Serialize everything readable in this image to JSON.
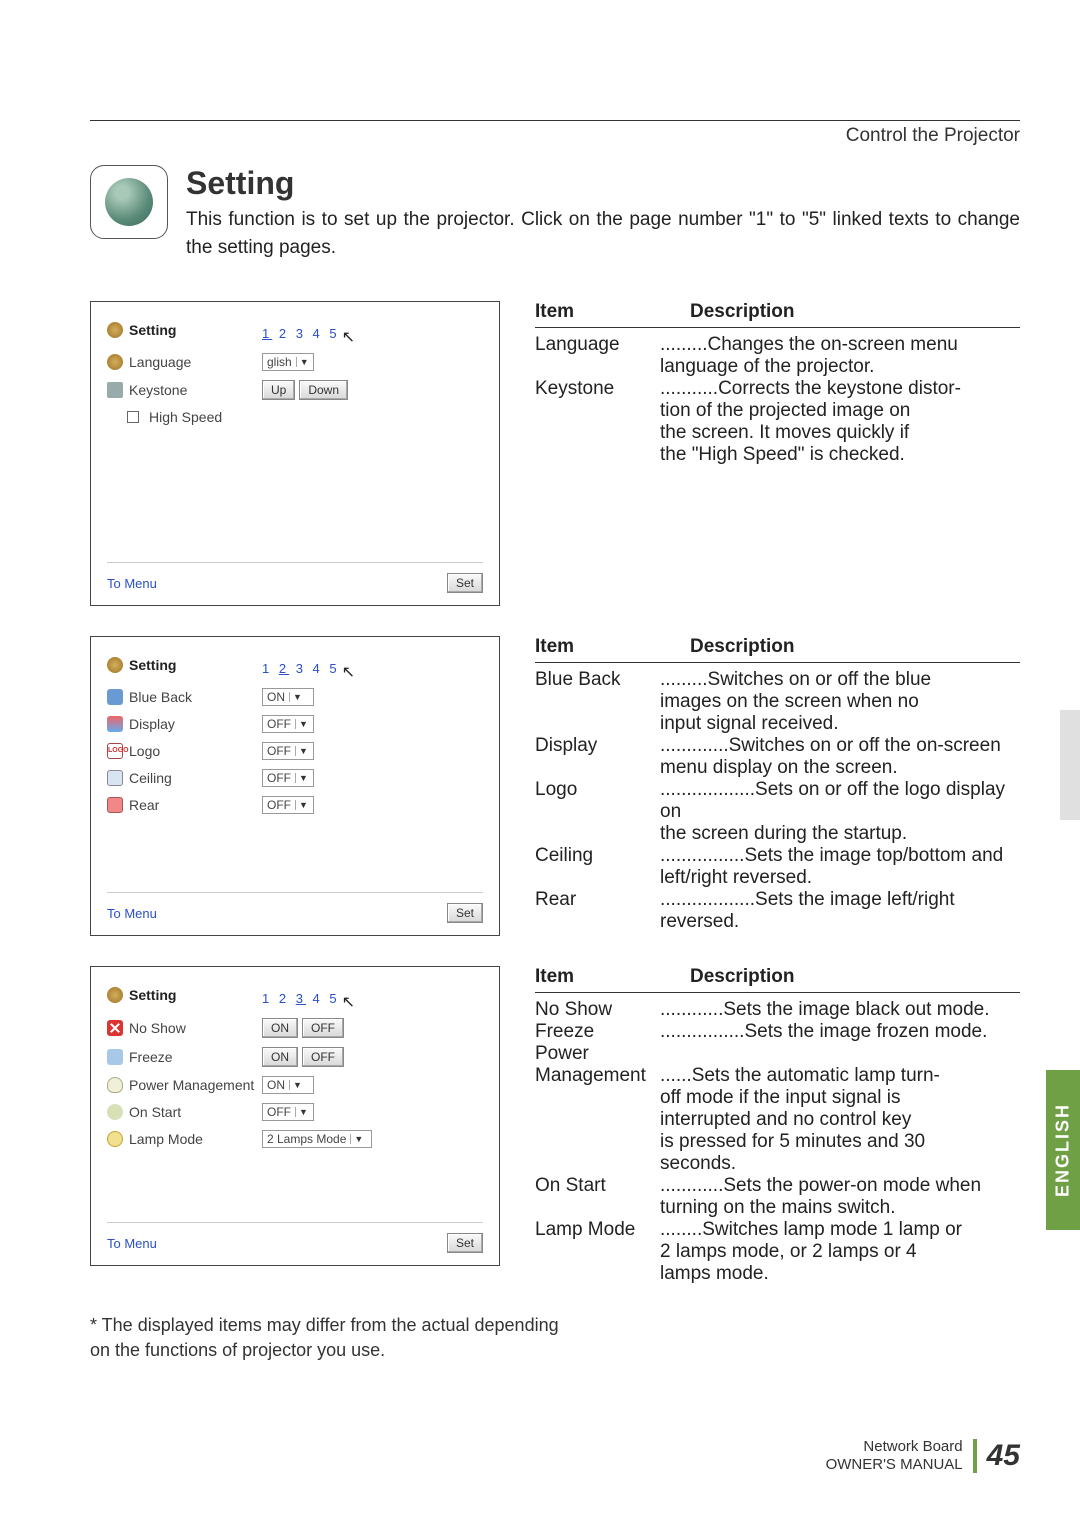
{
  "breadcrumb": "Control the Projector",
  "title": "Setting",
  "intro": "This function is to set up the projector. Click on the page number \"1\" to \"5\" linked texts to change the setting pages.",
  "pager_label": "1 2 3 4 5",
  "to_menu": "To Menu",
  "set_btn": "Set",
  "headers": {
    "item": "Item",
    "desc": "Description"
  },
  "panel1": {
    "title": "Setting",
    "language_label": "Language",
    "language_value": "glish",
    "keystone_label": "Keystone",
    "up": "Up",
    "down": "Down",
    "highspeed_label": "High Speed"
  },
  "desc1": {
    "language_term": "Language",
    "language_dots": " .........",
    "language_val": "Changes the on-screen menu",
    "language_cont": "language of the projector.",
    "keystone_term": "Keystone",
    "keystone_dots": "...........",
    "keystone_val": "Corrects the keystone distor-",
    "keystone_c1": "tion of the projected image on",
    "keystone_c2": "the screen. It moves quickly if",
    "keystone_c3": "the \"High Speed\" is checked."
  },
  "panel2": {
    "title": "Setting",
    "blueback": "Blue Back",
    "blueback_v": "ON",
    "display": "Display",
    "display_v": "OFF",
    "logo": "Logo",
    "logo_v": "OFF",
    "ceiling": "Ceiling",
    "ceiling_v": "OFF",
    "rear": "Rear",
    "rear_v": "OFF",
    "logo_icon_text": "LOGO"
  },
  "desc2": {
    "bb_term": "Blue Back",
    "bb_dots": " .........",
    "bb_val": "Switches on or off the blue",
    "bb_c1": "images on the screen when no",
    "bb_c2": "input signal received.",
    "dp_term": "Display",
    "dp_dots": " .............",
    "dp_val": "Switches on or off the on-screen",
    "dp_c1": "menu display on the screen.",
    "lg_term": "Logo",
    "lg_dots": " ..................",
    "lg_val": "Sets on or off the logo display on",
    "lg_c1": "the screen during the startup.",
    "cl_term": "Ceiling",
    "cl_dots": "................",
    "cl_val": "Sets the image top/bottom and",
    "cl_c1": "left/right reversed.",
    "rr_term": "Rear",
    "rr_dots": " ..................",
    "rr_val": "Sets the image left/right",
    "rr_c1": "reversed."
  },
  "panel3": {
    "title": "Setting",
    "noshow": "No Show",
    "on": "ON",
    "off": "OFF",
    "freeze": "Freeze",
    "pm": "Power Management",
    "pm_v": "ON",
    "onstart": "On Start",
    "onstart_v": "OFF",
    "lamp": "Lamp Mode",
    "lamp_v": "2 Lamps Mode"
  },
  "desc3": {
    "ns_term": "No Show",
    "ns_dots": " ............",
    "ns_val": "Sets the image black out mode.",
    "fz_term": "Freeze",
    "fz_dots": "................",
    "fz_val": "Sets the image frozen mode.",
    "pw_term": "Power",
    "mg_term": "Management",
    "mg_dots": "......",
    "mg_val": "Sets the automatic lamp turn-",
    "mg_c1": "off mode if the input signal is",
    "mg_c2": "interrupted and no control key",
    "mg_c3": "is pressed for 5 minutes and 30",
    "mg_c4": "seconds.",
    "os_term": "On Start",
    "os_dots": " ............",
    "os_val": "Sets the power-on mode when",
    "os_c1": "turning on the mains switch.",
    "lm_term": "Lamp Mode",
    "lm_dots": "........",
    "lm_val": "Switches lamp mode 1 lamp or",
    "lm_c1": "2 lamps mode, or 2 lamps or 4",
    "lm_c2": "lamps mode."
  },
  "footnote": "* The displayed items may differ from the actual depending on the functions of projector you use.",
  "footer": {
    "l1": "Network Board",
    "l2": "OWNER'S MANUAL",
    "page": "45"
  },
  "tab": "ENGLISH"
}
